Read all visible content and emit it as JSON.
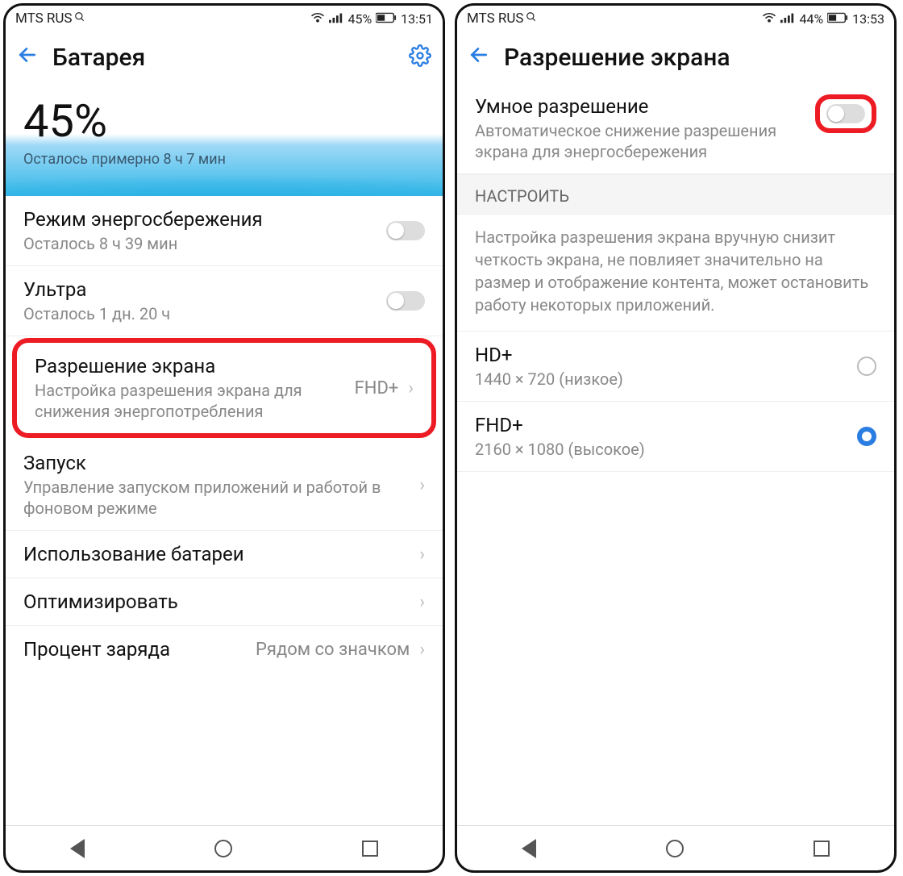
{
  "left": {
    "status": {
      "carrier": "MTS RUS",
      "battery_pct": "45%",
      "time": "13:51"
    },
    "appbar": {
      "title": "Батарея"
    },
    "hero": {
      "pct": "45%",
      "sub": "Осталось примерно 8 ч 7 мин"
    },
    "rows": {
      "powersave": {
        "title": "Режим энергосбережения",
        "sub": "Осталось 8 ч 39 мин"
      },
      "ultra": {
        "title": "Ультра",
        "sub": "Осталось 1 дн. 20 ч"
      },
      "resolution": {
        "title": "Разрешение экрана",
        "sub": "Настройка разрешения экрана для снижения энергопотребления",
        "value": "FHD+"
      },
      "launch": {
        "title": "Запуск",
        "sub": "Управление запуском приложений и работой в фоновом режиме"
      },
      "usage": {
        "title": "Использование батареи"
      },
      "optimize": {
        "title": "Оптимизировать"
      },
      "percent": {
        "title": "Процент заряда",
        "value": "Рядом со значком"
      }
    }
  },
  "right": {
    "status": {
      "carrier": "MTS RUS",
      "battery_pct": "44%",
      "time": "13:53"
    },
    "appbar": {
      "title": "Разрешение экрана"
    },
    "smart": {
      "title": "Умное разрешение",
      "sub": "Автоматическое снижение разрешения экрана для энергосбережения"
    },
    "section": "НАСТРОИТЬ",
    "info": "Настройка разрешения экрана вручную снизит четкость экрана, не повлияет значительно на размер и отображение контента, может остановить работу некоторых приложений.",
    "options": {
      "hd": {
        "title": "HD+",
        "sub": "1440 × 720 (низкое)"
      },
      "fhd": {
        "title": "FHD+",
        "sub": "2160 × 1080 (высокое)"
      }
    }
  }
}
